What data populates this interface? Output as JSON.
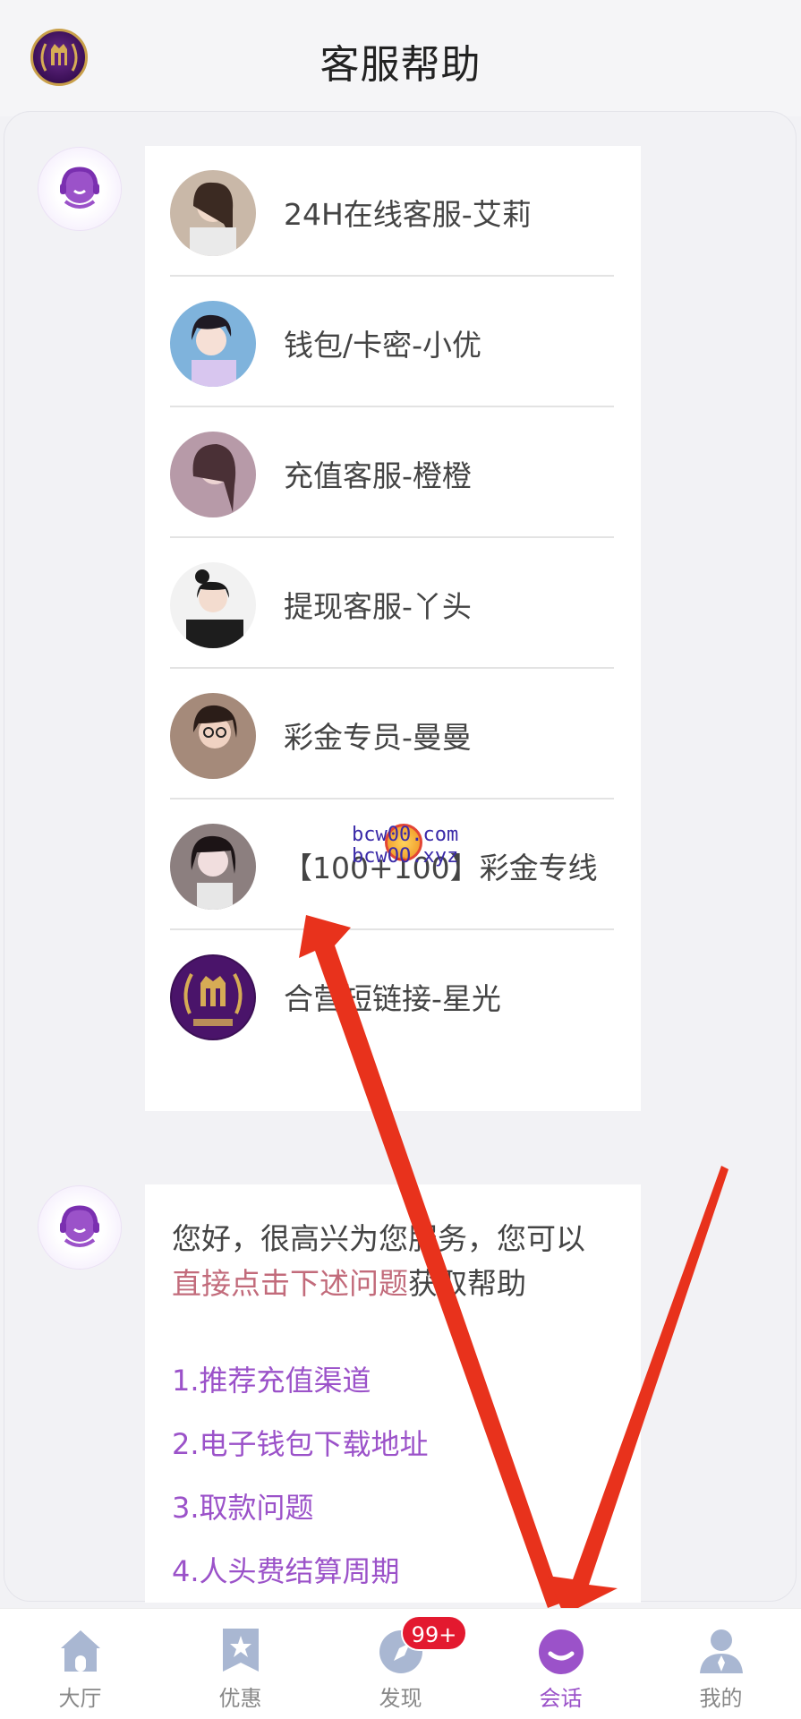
{
  "header": {
    "title": "客服帮助",
    "logo_icon": "crown-laurel-logo-icon"
  },
  "agents": [
    {
      "name": "24H在线客服-艾莉",
      "avatar_icon": "agent-photo-avatar"
    },
    {
      "name": "钱包/卡密-小优",
      "avatar_icon": "agent-photo-avatar"
    },
    {
      "name": "充值客服-橙橙",
      "avatar_icon": "agent-photo-avatar"
    },
    {
      "name": "提现客服-丫头",
      "avatar_icon": "agent-photo-avatar"
    },
    {
      "name": "彩金专员-曼曼",
      "avatar_icon": "agent-photo-avatar"
    },
    {
      "name": "【100+100】彩金专线",
      "avatar_icon": "agent-photo-avatar"
    },
    {
      "name": "合营短链接-星光",
      "avatar_icon": "brand-logo-avatar"
    }
  ],
  "help_message": {
    "text_before": "您好，很高兴为您服务，您可以",
    "highlight": "直接点击下述问题",
    "text_after": "获取帮助",
    "faqs": [
      "1.推荐充值渠道",
      "2.电子钱包下载地址",
      "3.取款问题",
      "4.人头费结算周期"
    ]
  },
  "watermark": {
    "line1": "bcw00.com",
    "line2": "bcwOO.xyz"
  },
  "nav": {
    "items": [
      {
        "label": "大厅",
        "icon": "home-icon"
      },
      {
        "label": "优惠",
        "icon": "star-icon"
      },
      {
        "label": "发现",
        "icon": "compass-icon"
      },
      {
        "label": "会话",
        "icon": "chat-bubble-icon"
      },
      {
        "label": "我的",
        "icon": "profile-icon"
      }
    ],
    "discover_badge": "99+",
    "active_index": 3
  },
  "colors": {
    "accent": "#9b52c9",
    "highlight": "#c26b7b",
    "badge": "#e3192f",
    "arrow": "#e8321c"
  }
}
